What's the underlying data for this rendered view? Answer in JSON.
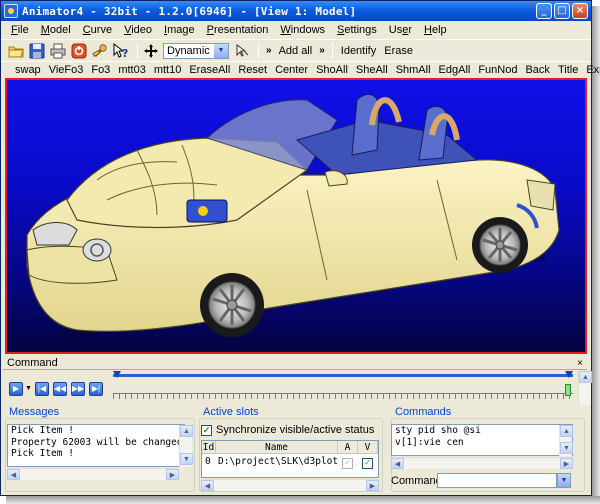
{
  "window": {
    "title": "Animator4 - 32bit - 1.2.0[6946] - [View 1: Model]",
    "controls": {
      "minimize": "_",
      "maximize": "□",
      "close": "×"
    }
  },
  "menu": [
    {
      "label": "File",
      "acc_index": 0
    },
    {
      "label": "Model",
      "acc_index": 0
    },
    {
      "label": "Curve",
      "acc_index": 0
    },
    {
      "label": "Video",
      "acc_index": 0
    },
    {
      "label": "Image",
      "acc_index": 0
    },
    {
      "label": "Presentation",
      "acc_index": 0
    },
    {
      "label": "Windows",
      "acc_index": 0
    },
    {
      "label": "Settings",
      "acc_index": 0
    },
    {
      "label": "User",
      "acc_index": 2
    },
    {
      "label": "Help",
      "acc_index": 0
    }
  ],
  "toolbar1": {
    "icons": [
      "open-folder-icon",
      "save-disk-icon",
      "print-icon",
      "record-icon",
      "tools-wrench-icon",
      "context-help-icon"
    ],
    "view_mode": "Dynamic",
    "add_all": "Add all",
    "identify": "Identify",
    "erase": "Erase",
    "chevron": "»"
  },
  "toolbar2": [
    "swap",
    "VieFo3",
    "Fo3",
    "mtt03",
    "mtt10",
    "EraseAll",
    "Reset",
    "Center",
    "ShoAll",
    "SheAll",
    "ShmAll",
    "EdgAll",
    "FunNod",
    "Back",
    "Title",
    "Explode"
  ],
  "command_bar": {
    "title": "Command",
    "close": "×"
  },
  "messages": {
    "title": "Messages",
    "lines": [
      "Pick Item !",
      "Property 62003 will be changed.",
      "Pick Item !"
    ]
  },
  "active_slots": {
    "title": "Active slots",
    "sync_label": "Synchronize visible/active status",
    "sync_checked": true,
    "columns": [
      "Id",
      "Name",
      "A",
      "V"
    ],
    "rows": [
      {
        "id": "0",
        "name": "D:\\project\\SLK\\d3plot",
        "a": true,
        "v": true
      }
    ]
  },
  "commands": {
    "title": "Commands",
    "lines": [
      "sty pid sho @si",
      "v[1]:vie cen"
    ],
    "input_label": "Command:",
    "input_value": ""
  },
  "colors": {
    "accent": "#0a5ee0",
    "viewport_top": "#1010e8",
    "viewport_bottom": "#030340",
    "car_body": "#f0e6a6",
    "viewport_border": "#e02020"
  }
}
